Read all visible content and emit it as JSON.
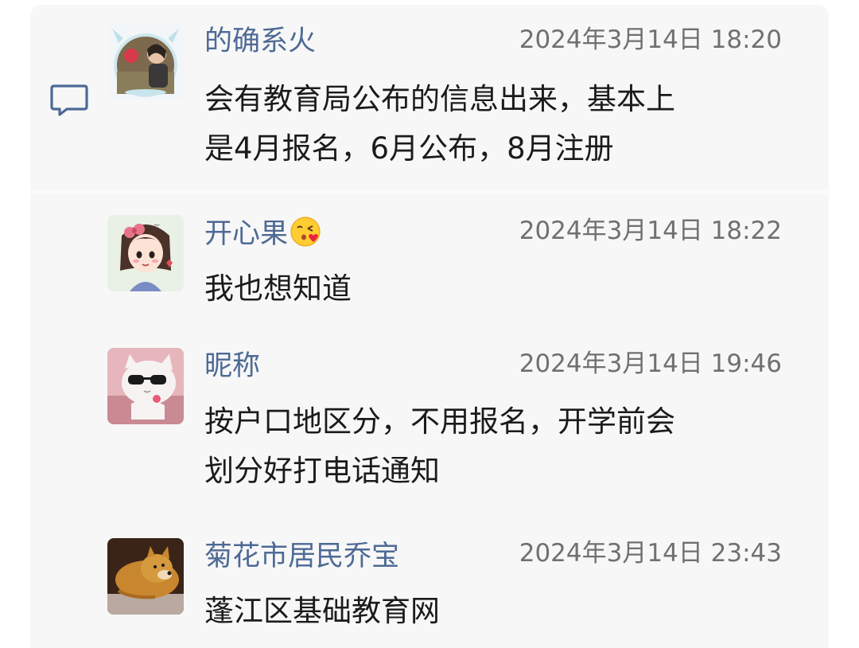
{
  "comments": [
    {
      "nickname": "的确系火",
      "time": "2024年3月14日 18:20",
      "lines": [
        "会有教育局公布的信息出来，基本上",
        "是4月报名，6月公布，8月注册"
      ]
    },
    {
      "nickname": "开心果",
      "nickname_emoji": "kissing-heart-emoji",
      "time": "2024年3月14日 18:22",
      "lines": [
        "我也想知道"
      ]
    },
    {
      "nickname": "昵称",
      "time": "2024年3月14日 19:46",
      "lines": [
        "按户口地区分，不用报名，开学前会",
        "划分好打电话通知"
      ]
    },
    {
      "nickname": "菊花市居民乔宝",
      "time": "2024年3月14日 23:43",
      "lines": [
        "蓬江区基础教育网"
      ]
    }
  ],
  "icons": {
    "reply": "comment-bubble-icon"
  },
  "colors": {
    "nickname": "#4e6a95",
    "timestamp": "#707070",
    "text": "#1b1b1b",
    "panel_background": "#f7f7f7"
  }
}
